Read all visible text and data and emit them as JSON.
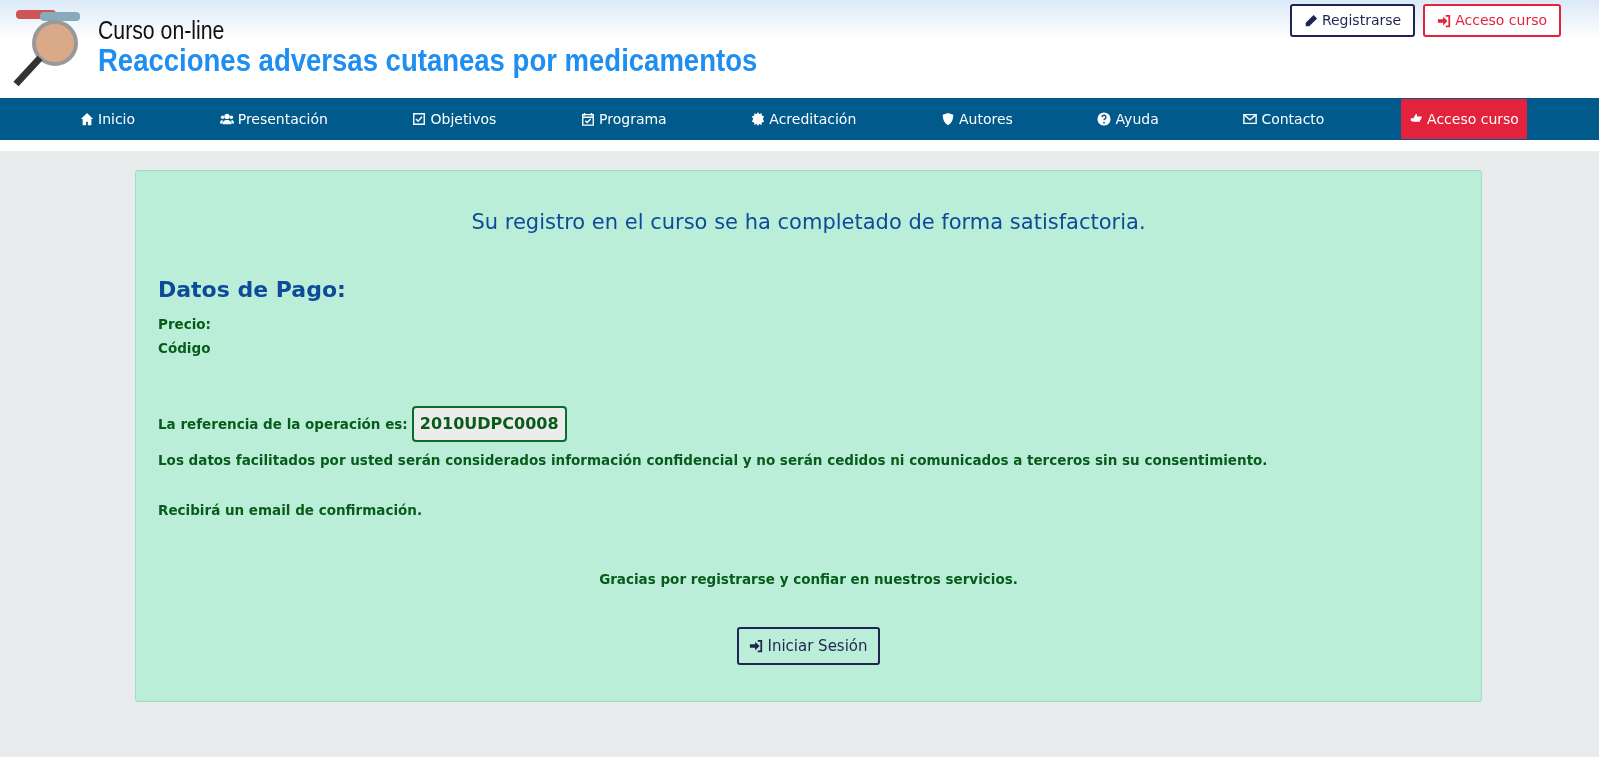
{
  "header": {
    "subtitle": "Curso on-line",
    "title": "Reacciones adversas cutaneas por medicamentos",
    "buttons": [
      {
        "label": "Registrarse",
        "kind": "register"
      },
      {
        "label": "Acceso curso",
        "kind": "access"
      }
    ]
  },
  "nav": [
    {
      "label": "Inicio",
      "selected": false
    },
    {
      "label": "Presentación",
      "selected": false
    },
    {
      "label": "Objetivos",
      "selected": false
    },
    {
      "label": "Programa",
      "selected": false
    },
    {
      "label": "Acreditación",
      "selected": false
    },
    {
      "label": "Autores",
      "selected": false
    },
    {
      "label": "Ayuda",
      "selected": false
    },
    {
      "label": "Contacto",
      "selected": false
    },
    {
      "label": "Acceso curso",
      "selected": true
    }
  ],
  "panel": {
    "message": "Su registro en el curso se ha completado de forma satisfactoria.",
    "payment_heading": "Datos de Pago:",
    "fields": [
      "Precio:",
      "Código"
    ],
    "reference_label": "La referencia de la operación es:",
    "reference": "2010UDPC0008",
    "privacy": "Los datos facilitados por usted serán considerados información confidencial y no serán cedidos ni comunicados a terceros sin su consentimiento.",
    "email_note": "Recibirá un email de confirmación.",
    "thanks": "Gracias por registrarse y confiar en nuestros servicios.",
    "login_button": "Iniciar Sesión"
  }
}
